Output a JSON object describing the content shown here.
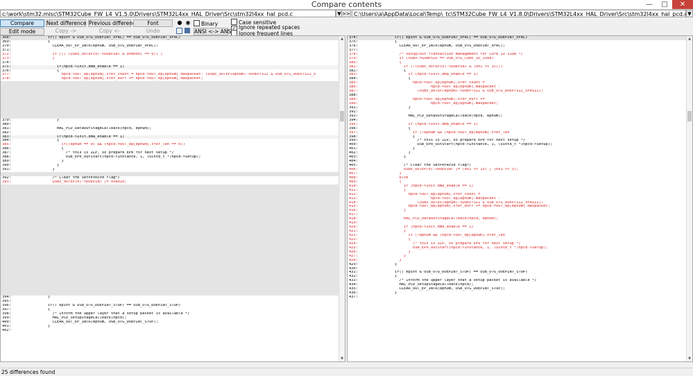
{
  "window": {
    "title": "Compare contents",
    "minimize_glyph": "—",
    "maximize_glyph": "□",
    "close_glyph": "✕"
  },
  "paths": {
    "left": "c:\\work\\stm32.misc\\STM32Cube_FW_L4_V1.5.0\\Drivers\\STM32L4xx_HAL_Driver\\Src\\stm32l4xx_hal_pcd.c",
    "right": "C:\\Users\\a\\AppData\\Local\\Temp\\_tc\\STM32Cube_FW_L4_V1.8.0\\Drivers\\STM32L4xx_HAL_Driver\\Src\\stm32l4xx_hal_pcd.c",
    "dropdown_glyph": "▼",
    "browse_label": ">>"
  },
  "toolbar": {
    "compare": "Compare",
    "next_difference": "Next difference",
    "previous_difference": "Previous difference",
    "font": "Font",
    "edit_mode": "Edit mode",
    "copy_right": "Copy ->",
    "copy_left": "Copy <-",
    "undo": "Undo",
    "binary": "Binary",
    "ansi": "ANSI <-> ANSI",
    "icons": {
      "find": "binoculars-icon",
      "find_next": "binoculars-next-icon",
      "window": "window-icon",
      "save": "save-icon"
    }
  },
  "options": {
    "case_sensitive": {
      "label": "Case sensitive",
      "checked": false
    },
    "ignore_repeated_spaces": {
      "label": "Ignore repeated spaces",
      "checked": true
    },
    "ignore_frequent_lines": {
      "label": "Ignore frequent lines",
      "checked": false
    }
  },
  "left_lines": [
    {
      "n": "368:",
      "t": "    if(( epint & USB_OTG_DOEPINT_XFRC) == USB_OTG_DOEPINT_XFRC)",
      "s": "grey"
    },
    {
      "n": "369:",
      "t": "    {",
      "s": ""
    },
    {
      "n": "370:",
      "t": "      CLEAR_OUT_EP_INTR(epnum, USB_OTG_DOEPINT_XFRC);",
      "s": ""
    },
    {
      "n": "371:",
      "t": "",
      "s": ""
    },
    {
      "n": "372:",
      "t": "      if ((( (USBx_OUTEP(0)->DOEPINT & 0x8000) == 0)) )",
      "s": "red"
    },
    {
      "n": "373:",
      "t": "      {",
      "s": "red"
    },
    {
      "n": "374:",
      "t": "",
      "s": ""
    },
    {
      "n": "375:",
      "t": "        if(hpcd->Init.dma_enable == 1)",
      "s": "light"
    },
    {
      "n": "376:",
      "t": "        {",
      "s": ""
    },
    {
      "n": "377:",
      "t": "          hpcd->OUT_ep[epnum].xfer_count = hpcd->OUT_ep[epnum].maxpacket- (USBx_OUTEP(epnum)->DOEPTSIZ & USB_OTG_DOEPTSIZ_X",
      "s": "red"
    },
    {
      "n": "378:",
      "t": "          hpcd->OUT_ep[epnum].xfer_buff += hpcd->OUT_ep[epnum].maxpacket;",
      "s": "red"
    },
    {
      "n": "",
      "t": "",
      "s": "filler"
    },
    {
      "n": "",
      "t": "",
      "s": "filler"
    },
    {
      "n": "",
      "t": "",
      "s": "filler"
    },
    {
      "n": "",
      "t": "",
      "s": "filler"
    },
    {
      "n": "",
      "t": "",
      "s": "filler"
    },
    {
      "n": "",
      "t": "",
      "s": "filler"
    },
    {
      "n": "",
      "t": "",
      "s": "filler"
    },
    {
      "n": "",
      "t": "",
      "s": "filler"
    },
    {
      "n": "",
      "t": "",
      "s": "filler"
    },
    {
      "n": "379:",
      "t": "        }",
      "s": ""
    },
    {
      "n": "380:",
      "t": "",
      "s": ""
    },
    {
      "n": "381:",
      "t": "        HAL_PCD_DataOutStageCallback(hpcd, epnum);",
      "s": ""
    },
    {
      "n": "382:",
      "t": "",
      "s": ""
    },
    {
      "n": "383:",
      "t": "        if(hpcd->Init.dma_enable == 1)",
      "s": "light"
    },
    {
      "n": "384:",
      "t": "        {",
      "s": ""
    },
    {
      "n": "385:",
      "t": "          if((epnum == 0) && (hpcd->OUT_ep[epnum].xfer_len == 0))",
      "s": "red"
    },
    {
      "n": "386:",
      "t": "          {",
      "s": ""
    },
    {
      "n": "387:",
      "t": "            /* this is ZLP, so prepare EP0 for next setup */",
      "s": ""
    },
    {
      "n": "388:",
      "t": "            USB_EP0_OutStart(hpcd->Instance, 1, (uint8_t *)hpcd->Setup);",
      "s": ""
    },
    {
      "n": "389:",
      "t": "          }",
      "s": ""
    },
    {
      "n": "390:",
      "t": "        }",
      "s": ""
    },
    {
      "n": "391:",
      "t": "      }",
      "s": ""
    },
    {
      "n": "",
      "t": "",
      "s": "filler"
    },
    {
      "n": "392:",
      "t": "      /* Clear the SetPktRcvd flag*/",
      "s": ""
    },
    {
      "n": "393:",
      "t": "      USBx_OUTEP(0)->DOEPINT |= 0x8020;",
      "s": "red"
    },
    {
      "n": "",
      "t": "",
      "s": "filler"
    },
    {
      "n": "",
      "t": "",
      "s": "filler"
    },
    {
      "n": "",
      "t": "",
      "s": "filler"
    },
    {
      "n": "",
      "t": "",
      "s": "filler"
    },
    {
      "n": "",
      "t": "",
      "s": "filler"
    },
    {
      "n": "",
      "t": "",
      "s": "filler"
    },
    {
      "n": "",
      "t": "",
      "s": "filler"
    },
    {
      "n": "",
      "t": "",
      "s": "filler"
    },
    {
      "n": "",
      "t": "",
      "s": "filler"
    },
    {
      "n": "",
      "t": "",
      "s": "filler"
    },
    {
      "n": "",
      "t": "",
      "s": "filler"
    },
    {
      "n": "",
      "t": "",
      "s": "filler"
    },
    {
      "n": "",
      "t": "",
      "s": "filler"
    },
    {
      "n": "",
      "t": "",
      "s": "filler"
    },
    {
      "n": "",
      "t": "",
      "s": "filler"
    },
    {
      "n": "",
      "t": "",
      "s": "filler"
    },
    {
      "n": "",
      "t": "",
      "s": "filler"
    },
    {
      "n": "",
      "t": "",
      "s": "filler"
    },
    {
      "n": "",
      "t": "",
      "s": "filler"
    },
    {
      "n": "",
      "t": "",
      "s": "filler"
    },
    {
      "n": "",
      "t": "",
      "s": "filler"
    },
    {
      "n": "",
      "t": "",
      "s": "filler"
    },
    {
      "n": "",
      "t": "",
      "s": "filler"
    },
    {
      "n": "",
      "t": "",
      "s": "filler"
    },
    {
      "n": "",
      "t": "",
      "s": "filler"
    },
    {
      "n": "",
      "t": "",
      "s": "filler"
    },
    {
      "n": "",
      "t": "",
      "s": "filler"
    },
    {
      "n": "394:",
      "t": "    }",
      "s": ""
    },
    {
      "n": "395:",
      "t": "",
      "s": ""
    },
    {
      "n": "396:",
      "t": "    if(( epint & USB_OTG_DOEPINT_STUP) == USB_OTG_DOEPINT_STUP)",
      "s": ""
    },
    {
      "n": "397:",
      "t": "    {",
      "s": ""
    },
    {
      "n": "398:",
      "t": "      /* Inform the upper layer that a setup packet is available */",
      "s": ""
    },
    {
      "n": "399:",
      "t": "      HAL_PCD_SetupStageCallback(hpcd);",
      "s": ""
    },
    {
      "n": "400:",
      "t": "      CLEAR_OUT_EP_INTR(epnum, USB_OTG_DOEPINT_STUP);",
      "s": ""
    },
    {
      "n": "401:",
      "t": "    }",
      "s": ""
    },
    {
      "n": "402:",
      "t": "",
      "s": ""
    }
  ],
  "right_lines": [
    {
      "n": "374:",
      "t": "    if(( epint & USB_OTG_DOEPINT_XFRC) == USB_OTG_DOEPINT_XFRC)",
      "s": "grey"
    },
    {
      "n": "375:",
      "t": "    {",
      "s": ""
    },
    {
      "n": "376:",
      "t": "      CLEAR_OUT_EP_INTR(epnum, USB_OTG_DOEPINT_XFRC);",
      "s": ""
    },
    {
      "n": "377:",
      "t": "",
      "s": ""
    },
    {
      "n": "378:",
      "t": "      /* setup/out transaction management for Core ID 310A */",
      "s": "red"
    },
    {
      "n": "379:",
      "t": "      if (USBx->GSNPSID == USB_OTG_CORE_ID_310A)",
      "s": "red"
    },
    {
      "n": "380:",
      "t": "      {",
      "s": "red"
    },
    {
      "n": "381:",
      "t": "        if (!(USBx_OUTEP(0)->DOEPINT & (0x1 << 15)))",
      "s": "red"
    },
    {
      "n": "382:",
      "t": "        {",
      "s": ""
    },
    {
      "n": "383:",
      "t": "          if (hpcd->Init.dma_enable == 1)",
      "s": "red"
    },
    {
      "n": "384:",
      "t": "          {",
      "s": ""
    },
    {
      "n": "385:",
      "t": "            hpcd->OUT_ep[epnum].xfer_count =",
      "s": "red"
    },
    {
      "n": "386:",
      "t": "                    hpcd->OUT_ep[epnum].maxpacket -",
      "s": "red"
    },
    {
      "n": "387:",
      "t": "              (USBx_OUTEP(epnum)->DOEPTSIZ & USB_OTG_DOEPTSIZ_XFRSIZ);",
      "s": "red"
    },
    {
      "n": "388:",
      "t": "",
      "s": ""
    },
    {
      "n": "389:",
      "t": "            hpcd->OUT_ep[epnum].xfer_buff +=",
      "s": "red"
    },
    {
      "n": "390:",
      "t": "                    hpcd->OUT_ep[epnum].maxpacket;",
      "s": "red"
    },
    {
      "n": "391:",
      "t": "          }",
      "s": ""
    },
    {
      "n": "392:",
      "t": "",
      "s": ""
    },
    {
      "n": "393:",
      "t": "          HAL_PCD_DataOutStageCallback(hpcd, epnum);",
      "s": ""
    },
    {
      "n": "394:",
      "t": "",
      "s": ""
    },
    {
      "n": "395:",
      "t": "          if (hpcd->Init.dma_enable == 1)",
      "s": "red"
    },
    {
      "n": "396:",
      "t": "          {",
      "s": ""
    },
    {
      "n": "397:",
      "t": "            if (!epnum && (hpcd->OUT_ep[epnum].xfer_len",
      "s": "red"
    },
    {
      "n": "398:",
      "t": "            {",
      "s": ""
    },
    {
      "n": "399:",
      "t": "              /* this is ZLP, so prepare EP0 for next setup */",
      "s": ""
    },
    {
      "n": "400:",
      "t": "              USB_EP0_OutStart(hpcd->Instance, 1, (uint8_t *)hpcd->Setup);",
      "s": ""
    },
    {
      "n": "401:",
      "t": "            }",
      "s": ""
    },
    {
      "n": "402:",
      "t": "          }",
      "s": ""
    },
    {
      "n": "403:",
      "t": "        }",
      "s": ""
    },
    {
      "n": "404:",
      "t": "",
      "s": ""
    },
    {
      "n": "405:",
      "t": "        /* Clear the SetPktRcvd flag*/",
      "s": ""
    },
    {
      "n": "406:",
      "t": "        USBx_OUTEP(0)->DOEPINT |= (0x1 << 15) | (0x1 << 5);",
      "s": "red"
    },
    {
      "n": "407:",
      "t": "      }",
      "s": "red"
    },
    {
      "n": "408:",
      "t": "      else",
      "s": "red"
    },
    {
      "n": "409:",
      "t": "      {",
      "s": "red"
    },
    {
      "n": "410:",
      "t": "        if (hpcd->Init.dma_enable == 1)",
      "s": "red"
    },
    {
      "n": "411:",
      "t": "        {",
      "s": "red"
    },
    {
      "n": "412:",
      "t": "          hpcd->OUT_ep[epnum].xfer_count =",
      "s": "red"
    },
    {
      "n": "413:",
      "t": "                    hpcd->OUT_ep[epnum].maxpacket -",
      "s": "red"
    },
    {
      "n": "414:",
      "t": "              (USBx_OUTEP(epnum)->DOEPTSIZ & USB_OTG_DOEPTSIZ_XFRSIZ);",
      "s": "red"
    },
    {
      "n": "415:",
      "t": "          hpcd->OUT_ep[epnum].xfer_buff += hpcd->OUT_ep[epnum].maxpacket;",
      "s": "red"
    },
    {
      "n": "416:",
      "t": "        }",
      "s": "red"
    },
    {
      "n": "417:",
      "t": "",
      "s": "red"
    },
    {
      "n": "418:",
      "t": "        HAL_PCD_DataOutStageCallback(hpcd, epnum);",
      "s": "red"
    },
    {
      "n": "419:",
      "t": "",
      "s": "red"
    },
    {
      "n": "420:",
      "t": "        if (hpcd->Init.dma_enable == 1)",
      "s": "red"
    },
    {
      "n": "421:",
      "t": "        {",
      "s": "red"
    },
    {
      "n": "422:",
      "t": "          if (!epnum && (hpcd->OUT_ep[epnum].xfer_len",
      "s": "red"
    },
    {
      "n": "423:",
      "t": "          {",
      "s": "red"
    },
    {
      "n": "424:",
      "t": "            /* this is ZLP, so prepare EP0 for next setup */",
      "s": "red"
    },
    {
      "n": "425:",
      "t": "            USB_EP0_OutStart(hpcd->Instance, 1, (uint8_t *)hpcd->Setup);",
      "s": "red"
    },
    {
      "n": "426:",
      "t": "          }",
      "s": "red"
    },
    {
      "n": "427:",
      "t": "        }",
      "s": "red"
    },
    {
      "n": "428:",
      "t": "      }",
      "s": "red"
    },
    {
      "n": "429:",
      "t": "    }",
      "s": ""
    },
    {
      "n": "430:",
      "t": "",
      "s": ""
    },
    {
      "n": "431:",
      "t": "    if(( epint & USB_OTG_DOEPINT_STUP) == USB_OTG_DOEPINT_STUP)",
      "s": ""
    },
    {
      "n": "432:",
      "t": "    {",
      "s": ""
    },
    {
      "n": "433:",
      "t": "      /* Inform the upper layer that a setup packet is available */",
      "s": ""
    },
    {
      "n": "434:",
      "t": "      HAL_PCD_SetupStageCallback(hpcd);",
      "s": ""
    },
    {
      "n": "435:",
      "t": "      CLEAR_OUT_EP_INTR(epnum, USB_OTG_DOEPINT_STUP);",
      "s": ""
    },
    {
      "n": "436:",
      "t": "    }",
      "s": ""
    },
    {
      "n": "437:",
      "t": "",
      "s": ""
    }
  ],
  "status": {
    "text": "25 differences found"
  },
  "colors": {
    "diff_text": "#d62020",
    "current_line": "#e4e4e4",
    "close_button": "#c7423a"
  }
}
